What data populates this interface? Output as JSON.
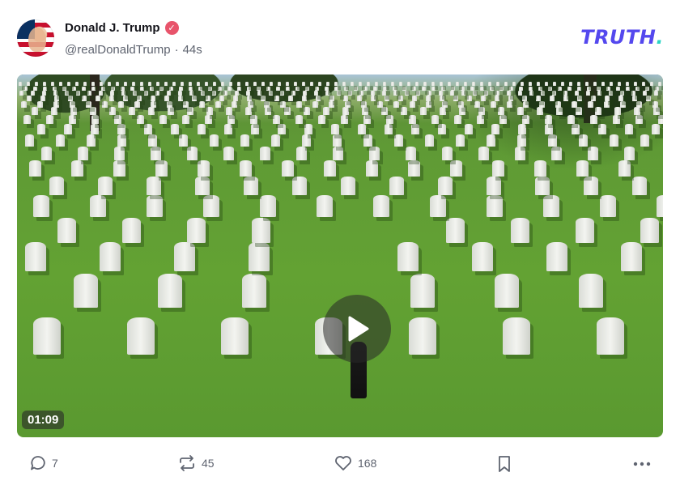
{
  "post": {
    "author": {
      "display_name": "Donald J. Trump",
      "handle": "@realDonaldTrump",
      "verified_icon": "verified-badge-icon",
      "verified_color": "#e8546b"
    },
    "meta_separator": "·",
    "timestamp": "44s",
    "brand": {
      "logo_text": "TRUTH",
      "logo_dot": ".",
      "brand_color": "#5448ee",
      "dot_color": "#2bd4c4"
    },
    "video": {
      "duration": "01:09",
      "play_icon": "play-icon"
    },
    "actions": {
      "replies": "7",
      "retruths": "45",
      "likes": "168",
      "reply_icon": "reply-icon",
      "retruth_icon": "retruth-icon",
      "like_icon": "heart-icon",
      "bookmark_icon": "bookmark-icon",
      "more_icon": "more-icon"
    }
  }
}
